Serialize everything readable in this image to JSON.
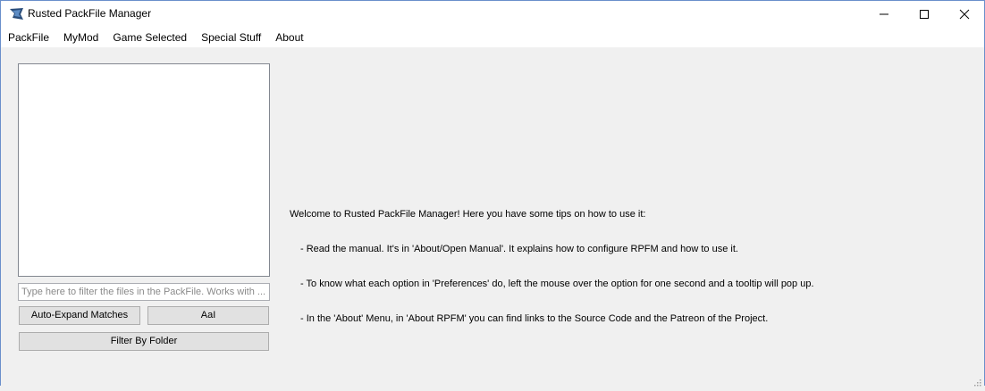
{
  "window": {
    "title": "Rusted PackFile Manager",
    "icon": "rpfm-app-icon",
    "controls": [
      "minimize-icon",
      "maximize-icon",
      "close-icon"
    ]
  },
  "menu": {
    "items": [
      "PackFile",
      "MyMod",
      "Game Selected",
      "Special Stuff",
      "About"
    ]
  },
  "sidebar": {
    "filter_placeholder": "Type here to filter the files in the PackFile. Works with ...",
    "filter_value": "",
    "auto_expand_label": "Auto-Expand Matches",
    "case_label": "AaI",
    "filter_folder_label": "Filter By Folder"
  },
  "welcome": {
    "heading": "Welcome to Rusted PackFile Manager! Here you have some tips on how to use it:",
    "tips": [
      "- Read the manual. It's in 'About/Open Manual'. It explains how to configure RPFM and how to use it.",
      "- To know what each option in 'Preferences' do, left the mouse over the option for one second and a tooltip will pop up.",
      "- In the 'About' Menu, in 'About RPFM' you can find links to the Source Code and the Patreon of the Project."
    ]
  },
  "colors": {
    "window_border": "#6a8fcb",
    "background": "#f0f0f0",
    "button_face": "#e1e1e1"
  }
}
